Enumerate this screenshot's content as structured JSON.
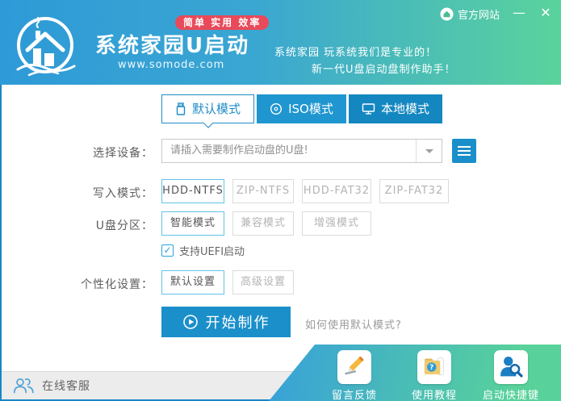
{
  "window": {
    "official_site": "官方网站",
    "minimize": "—",
    "close": "✕"
  },
  "header": {
    "title": "系统家园U启动",
    "url": "www.somode.com",
    "badge": "简单 实用 效率",
    "slogan_line1": "系统家园 玩系统我们是专业的！",
    "slogan_line2": "新一代U盘启动盘制作助手！"
  },
  "tabs": [
    {
      "label": "默认模式",
      "active": true
    },
    {
      "label": "ISO模式",
      "active": false
    },
    {
      "label": "本地模式",
      "active": false
    }
  ],
  "form": {
    "device_label": "选择设备：",
    "device_placeholder": "请插入需要制作启动盘的U盘!",
    "write_label": "写入模式：",
    "write_options": [
      "HDD-NTFS",
      "ZIP-NTFS",
      "HDD-FAT32",
      "ZIP-FAT32"
    ],
    "write_selected": "HDD-NTFS",
    "partition_label": "U盘分区：",
    "partition_options": [
      "智能模式",
      "兼容模式",
      "增强模式"
    ],
    "partition_selected": "智能模式",
    "uefi_label": "支持UEFI启动",
    "uefi_checked": true,
    "personalize_label": "个性化设置：",
    "personalize_options": [
      "默认设置",
      "高级设置"
    ],
    "personalize_selected": "默认设置",
    "start_label": "开始制作",
    "help_text": "如何使用默认模式?"
  },
  "footer": {
    "online_service": "在线客服",
    "shortcuts": [
      "留言反馈",
      "使用教程",
      "启动快捷键"
    ]
  },
  "icons": {
    "check": "✓",
    "question": "?"
  },
  "colors": {
    "header_gradient_start": "#2e9ad7",
    "header_gradient_end": "#5bd39c",
    "primary_blue": "#1a8fca",
    "badge_red": "#e84a5a",
    "selected_border": "#62c2e6",
    "window_border": "#1787c5"
  }
}
